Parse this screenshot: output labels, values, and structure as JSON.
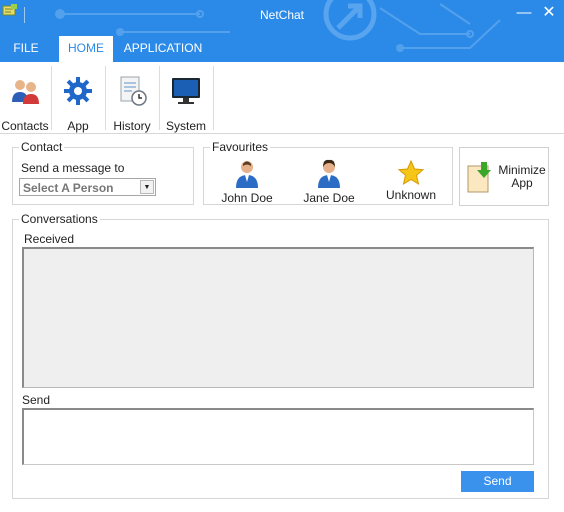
{
  "window": {
    "title": "NetChat",
    "minimize_glyph": "—",
    "close_glyph": "✕"
  },
  "tabs": [
    {
      "label": "FILE"
    },
    {
      "label": "HOME"
    },
    {
      "label": "APPLICATION"
    }
  ],
  "ribbon": {
    "buttons": [
      {
        "label": "Contacts",
        "icon": "contacts-icon"
      },
      {
        "label": "App",
        "icon": "gear-icon"
      },
      {
        "label": "History",
        "icon": "history-icon"
      },
      {
        "label": "System",
        "icon": "monitor-icon"
      }
    ]
  },
  "contact": {
    "title": "Contact",
    "send_to_label": "Send a message to",
    "selected": "Select A Person"
  },
  "favourites": {
    "title": "Favourites",
    "items": [
      {
        "label": "John Doe",
        "icon": "person-icon"
      },
      {
        "label": "Jane Doe",
        "icon": "person-icon"
      },
      {
        "label": "Unknown",
        "icon": "star-icon"
      }
    ]
  },
  "minimize_app": {
    "label_line1": "Minimize",
    "label_line2": "App"
  },
  "conversations": {
    "title": "Conversations",
    "received_label": "Received",
    "send_label": "Send",
    "send_button": "Send"
  },
  "colors": {
    "accent": "#2b8ae8",
    "button": "#3b92ec"
  }
}
